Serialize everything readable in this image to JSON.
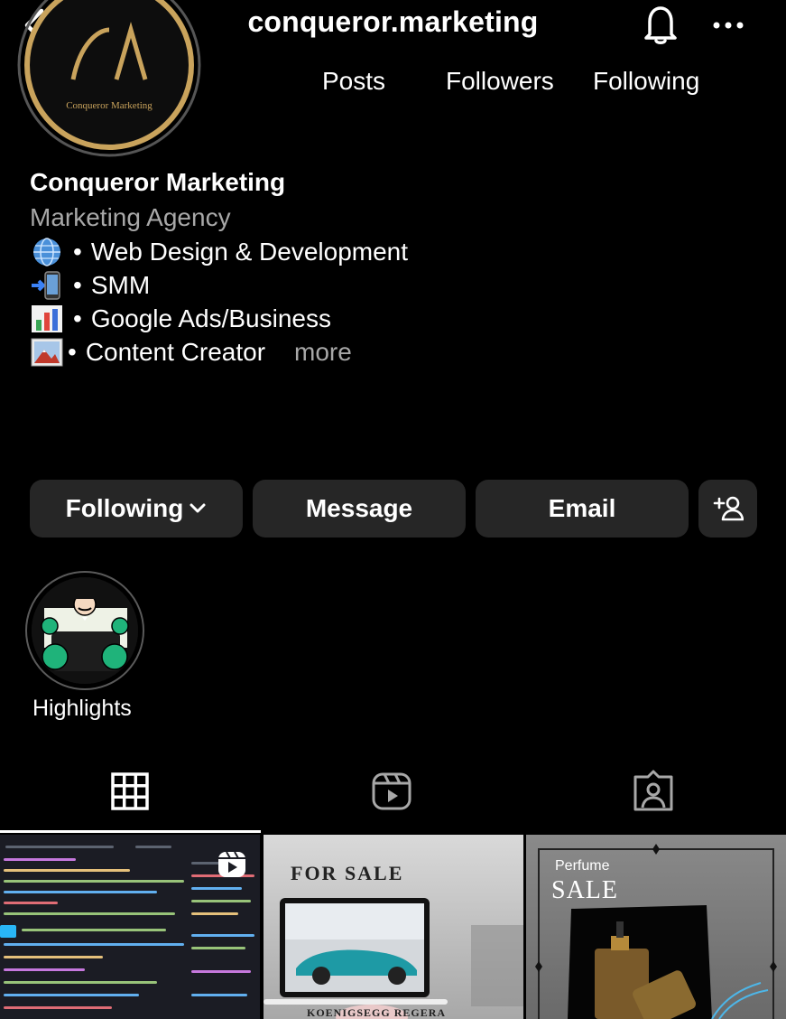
{
  "header": {
    "title": "conqueror.marketing",
    "back_icon": "chevron-left-icon",
    "bell_icon": "bell-icon",
    "more_icon": "ellipsis-icon"
  },
  "avatar": {
    "logo_text": "Conqueror Marketing",
    "ring_color": "#c9a35c"
  },
  "stats": {
    "posts_label": "Posts",
    "followers_label": "Followers",
    "following_label": "Following"
  },
  "bio": {
    "name": "Conqueror Marketing",
    "category": "Marketing Agency",
    "lines": [
      {
        "emoji": "globe-icon",
        "bullet": "•",
        "text": "Web Design & Development"
      },
      {
        "emoji": "mobile-arrow-icon",
        "bullet": "•",
        "text": "SMM"
      },
      {
        "emoji": "bar-chart-icon",
        "bullet": "•",
        "text": "Google Ads/Business"
      },
      {
        "emoji": "picture-icon",
        "bullet": "•",
        "text": "Content Creator"
      }
    ],
    "more": "more"
  },
  "actions": {
    "following": "Following",
    "message": "Message",
    "email": "Email",
    "add_user_icon": "add-user-icon"
  },
  "highlights": [
    {
      "label": "Highlights"
    }
  ],
  "tabs": [
    {
      "icon": "grid-icon",
      "active": true
    },
    {
      "icon": "reels-icon",
      "active": false
    },
    {
      "icon": "tagged-icon",
      "active": false
    }
  ],
  "posts": {
    "p2": {
      "heading": "For Sale",
      "caption": "Koenigsegg Regera"
    },
    "p3": {
      "heading": "Perfume",
      "subheading": "SALE"
    }
  },
  "colors": {
    "background": "#000000",
    "button_bg": "#262626",
    "secondary_text": "#a8a8a8"
  }
}
